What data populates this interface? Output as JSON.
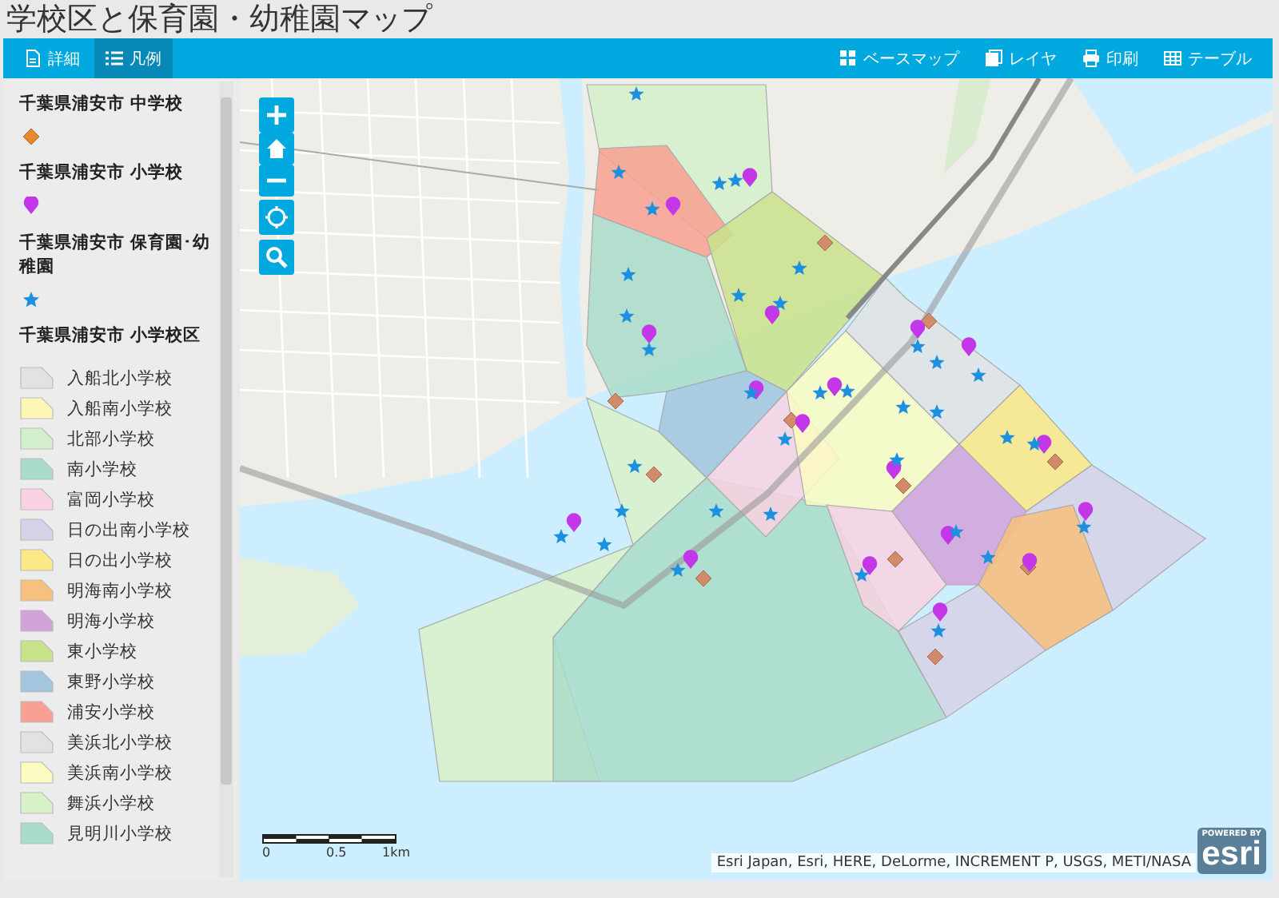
{
  "title": "学校区と保育園・幼稚園マップ",
  "toolbar": {
    "left": [
      {
        "label": "詳細",
        "kind": "details",
        "selected": false
      },
      {
        "label": "凡例",
        "kind": "legend",
        "selected": true
      }
    ],
    "right": [
      {
        "label": "ベースマップ",
        "kind": "basemap"
      },
      {
        "label": "レイヤ",
        "kind": "layers"
      },
      {
        "label": "印刷",
        "kind": "print"
      },
      {
        "label": "テーブル",
        "kind": "table"
      }
    ]
  },
  "legend": [
    {
      "title": "千葉県浦安市 中学校",
      "kind": "diamond"
    },
    {
      "title": "千葉県浦安市 小学校",
      "kind": "pin"
    },
    {
      "title": "千葉県浦安市 保育園･幼稚園",
      "kind": "star"
    },
    {
      "title": "千葉県浦安市 小学校区",
      "kind": "polygons",
      "items": [
        {
          "label": "入船北小学校",
          "color": "#e2e2e2"
        },
        {
          "label": "入船南小学校",
          "color": "#fdf6b4"
        },
        {
          "label": "北部小学校",
          "color": "#d3eecb"
        },
        {
          "label": "南小学校",
          "color": "#a9dcc9"
        },
        {
          "label": "富岡小学校",
          "color": "#f8d2e2"
        },
        {
          "label": "日の出南小学校",
          "color": "#d6d1e6"
        },
        {
          "label": "日の出小学校",
          "color": "#fbe886"
        },
        {
          "label": "明海南小学校",
          "color": "#f8c07e"
        },
        {
          "label": "明海小学校",
          "color": "#d2a2da"
        },
        {
          "label": "東小学校",
          "color": "#c9e28a"
        },
        {
          "label": "東野小学校",
          "color": "#a3c6de"
        },
        {
          "label": "浦安小学校",
          "color": "#f8a091"
        },
        {
          "label": "美浜北小学校",
          "color": "#e2e2e2"
        },
        {
          "label": "美浜南小学校",
          "color": "#fbfbc2"
        },
        {
          "label": "舞浜小学校",
          "color": "#d9f1c9"
        },
        {
          "label": "見明川小学校",
          "color": "#a9dcc9"
        }
      ]
    }
  ],
  "map": {
    "scale_labels": [
      "0",
      "0.5",
      "1km"
    ],
    "attribution": "Esri Japan, Esri, HERE, DeLorme, INCREMENT P, USGS, METI/NASA",
    "logo": {
      "tagline": "POWERED BY",
      "brand": "esri"
    }
  }
}
